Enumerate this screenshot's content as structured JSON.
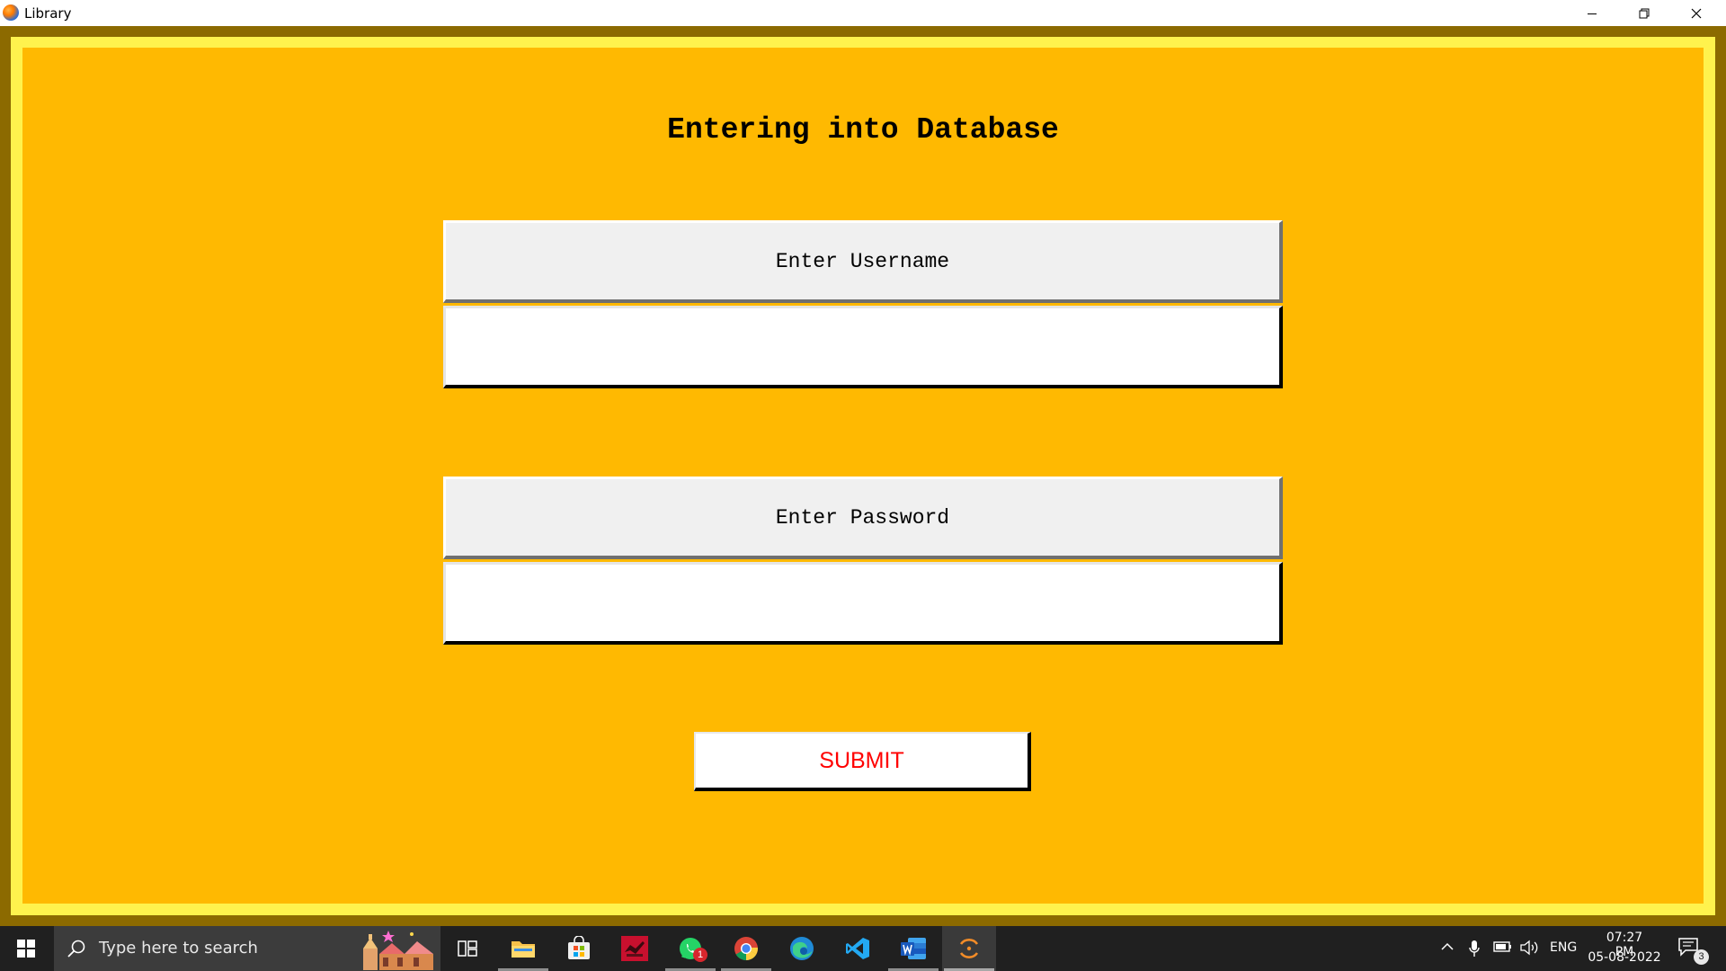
{
  "window": {
    "title": "Library",
    "app_icon": "library-app-icon",
    "controls": [
      "minimize-icon",
      "restore-icon",
      "close-icon"
    ]
  },
  "form": {
    "heading": "Entering into Database",
    "username_label": "Enter Username",
    "username_value": "",
    "password_label": "Enter Password",
    "password_value": "",
    "submit_label": "SUBMIT"
  },
  "colors": {
    "frame_dark": "#8c6a00",
    "frame_light": "#fff24d",
    "panel_bg": "#ffb901",
    "submit_text": "#ff0000",
    "taskbar_bg": "#202020"
  },
  "taskbar": {
    "search_placeholder": "Type here to search",
    "apps": [
      {
        "name": "task-view-icon"
      },
      {
        "name": "file-explorer-icon"
      },
      {
        "name": "microsoft-store-icon"
      },
      {
        "name": "red-app-icon"
      },
      {
        "name": "whatsapp-icon",
        "badge": "1"
      },
      {
        "name": "chrome-icon"
      },
      {
        "name": "edge-icon"
      },
      {
        "name": "vscode-icon"
      },
      {
        "name": "word-icon"
      },
      {
        "name": "library-app-icon"
      }
    ],
    "tray": {
      "language": "ENG",
      "time": "07:27 PM",
      "date": "05-08-2022",
      "notification_count": "3"
    }
  }
}
